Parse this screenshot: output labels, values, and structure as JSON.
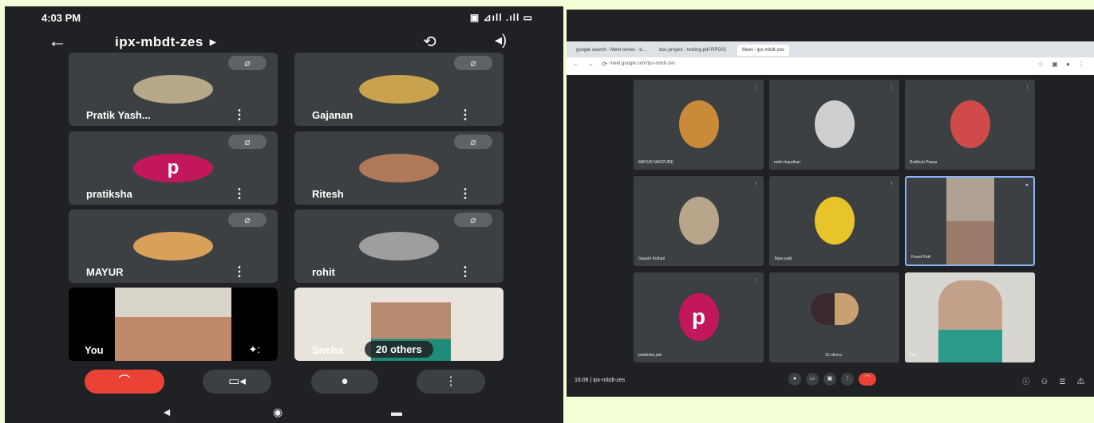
{
  "phone": {
    "status_time": "4:03 PM",
    "status_icons": "▣ ⊿ıll .ıll ▭",
    "meeting_code": "ipx-mbdt-zes",
    "back_glyph": "←",
    "cam_glyph": "⟲",
    "speaker_glyph": "◂)",
    "mute_glyph": "⌀",
    "more_glyph": "⋮",
    "participants": [
      {
        "name": "Pratik Yash...",
        "color": "#b8a88a"
      },
      {
        "name": "Gajanan",
        "color": "#c9a24e"
      },
      {
        "name": "pratiksha",
        "color": "#c2185b",
        "initial": "p"
      },
      {
        "name": "Ritesh",
        "color": "#b07a5a"
      },
      {
        "name": "MAYUR",
        "color": "#d9a05a"
      },
      {
        "name": "rohit",
        "color": "#9e9e9e"
      }
    ],
    "self_label": "You",
    "self_effects_glyph": "✦:",
    "sneha_label": "Sneha",
    "others_label": "20 others",
    "controls": {
      "end": "⌒",
      "camera": "▭◂",
      "mic": "●",
      "more": "⋮"
    },
    "nav": [
      "◄",
      "◉",
      "▬"
    ],
    "colors": {
      "end_call": "#ea4335",
      "bg": "#202124",
      "tile": "#3c4043"
    }
  },
  "browser": {
    "tabs": [
      "google search - Meet series - b...",
      "doc-project - testing-pdf-RPGIS",
      "Meet - ipx-mbdt-zes"
    ],
    "url": "meet.google.com/ipx-mbdt-zes",
    "nav_glyphs": "← → ⟳",
    "right_glyphs": "☆ ▣ ● ⋮",
    "tiles": [
      {
        "name": "MAYUR NAGPURE",
        "color": "#c98a3a"
      },
      {
        "name": "rohit chaudhari",
        "color": "#cfcfcf"
      },
      {
        "name": "Ruthhuh Pawar",
        "color": "#d04a4a"
      },
      {
        "name": "Gayatri Kothari",
        "color": "#b7a68a"
      },
      {
        "name": "Tejas patil",
        "color": "#e6c42a"
      },
      {
        "name": "Pranit Patil",
        "color": "#9a7b6a"
      },
      {
        "name": "pratiksha jain",
        "color": "#c2185b",
        "initial": "p"
      },
      {
        "name": "15 others",
        "color": "#6a4a5a"
      },
      {
        "name": "You",
        "color": "#a3a39c"
      }
    ],
    "bottom_left": "16:06  |  ipx-mbdt-zes",
    "bottom_right": "ⓘ ⚇ ☰ ⚠"
  }
}
